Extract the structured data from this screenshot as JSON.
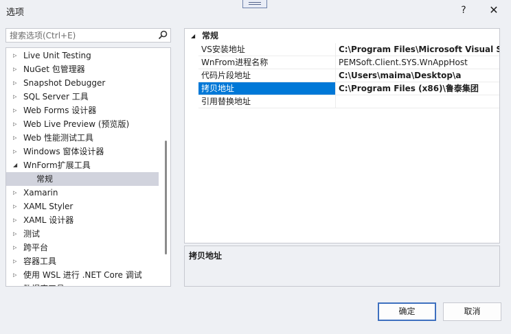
{
  "window": {
    "title": "选项"
  },
  "titlebar": {
    "help_label": "?",
    "close_label": "✕"
  },
  "search": {
    "placeholder": "搜索选项(Ctrl+E)",
    "value": ""
  },
  "tree": {
    "items": [
      {
        "label": "Live Unit Testing",
        "expanded": false
      },
      {
        "label": "NuGet 包管理器",
        "expanded": false
      },
      {
        "label": "Snapshot Debugger",
        "expanded": false
      },
      {
        "label": "SQL Server 工具",
        "expanded": false
      },
      {
        "label": "Web Forms 设计器",
        "expanded": false
      },
      {
        "label": "Web Live Preview (预览版)",
        "expanded": false
      },
      {
        "label": "Web 性能测试工具",
        "expanded": false
      },
      {
        "label": "Windows 窗体设计器",
        "expanded": false
      },
      {
        "label": "WnForm扩展工具",
        "expanded": true
      },
      {
        "label": "常规",
        "child": true,
        "selected": true
      },
      {
        "label": "Xamarin",
        "expanded": false
      },
      {
        "label": "XAML Styler",
        "expanded": false
      },
      {
        "label": "XAML 设计器",
        "expanded": false
      },
      {
        "label": "测试",
        "expanded": false
      },
      {
        "label": "跨平台",
        "expanded": false
      },
      {
        "label": "容器工具",
        "expanded": false
      },
      {
        "label": "使用 WSL 进行 .NET Core 调试",
        "expanded": false
      },
      {
        "label": "数据库工具",
        "expanded": false
      }
    ]
  },
  "property_grid": {
    "category": "常规",
    "rows": [
      {
        "name": "VS安装地址",
        "value": "C:\\Program Files\\Microsoft Visual Studio",
        "bold": true
      },
      {
        "name": "WnFrom进程名称",
        "value": "PEMSoft.Client.SYS.WnAppHost",
        "bold": false
      },
      {
        "name": "代码片段地址",
        "value": "C:\\Users\\maima\\Desktop\\a",
        "bold": true
      },
      {
        "name": "拷贝地址",
        "value": "C:\\Program Files (x86)\\鲁泰集团",
        "bold": true,
        "selected": true
      },
      {
        "name": "引用替换地址",
        "value": "",
        "bold": false
      }
    ]
  },
  "description": {
    "title": "拷贝地址"
  },
  "buttons": {
    "ok": "确定",
    "cancel": "取消"
  },
  "colors": {
    "selection": "#0078d7",
    "tree_selection": "#d1d3dd",
    "ok_border": "#3d6fbf"
  }
}
